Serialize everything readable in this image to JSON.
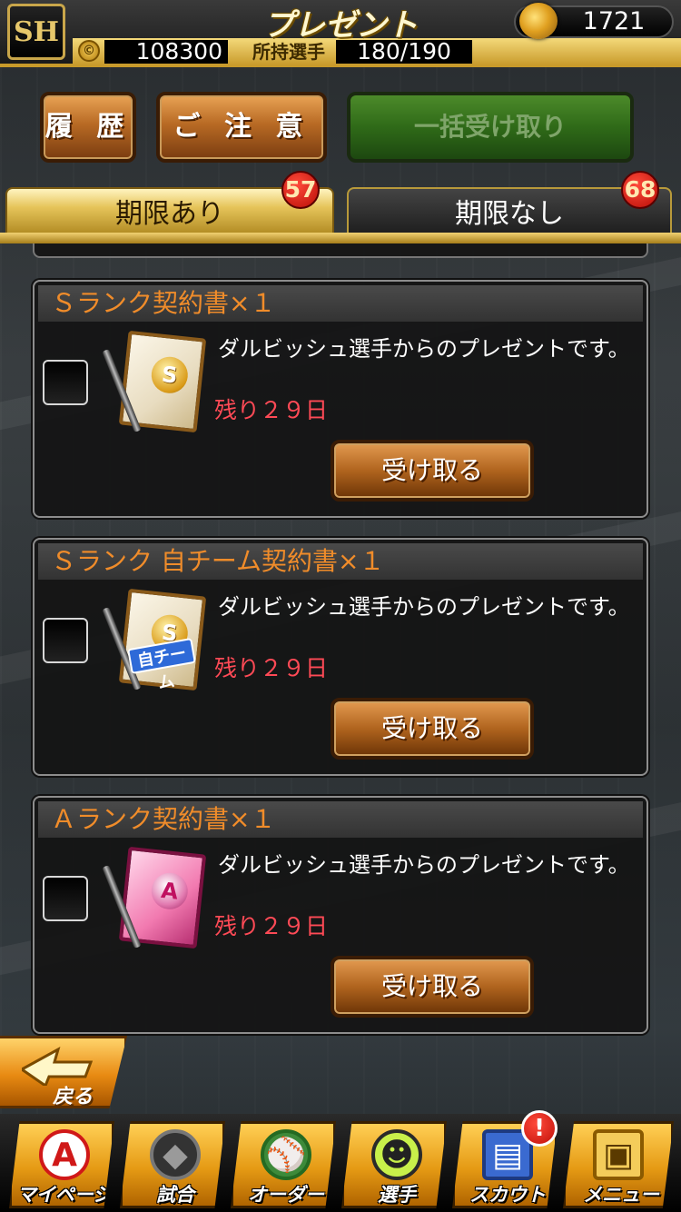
{
  "header": {
    "title": "プレゼント",
    "logo_text": "SH",
    "currency_value": "1721",
    "coins_value": "108300",
    "players_label": "所持選手",
    "players_value": "180/190"
  },
  "top_buttons": {
    "history": "履 歴",
    "caution": "ご 注 意",
    "receive_all": "一括受け取り"
  },
  "tabs": [
    {
      "label": "期限あり",
      "badge": "57",
      "active": true
    },
    {
      "label": "期限なし",
      "badge": "68",
      "active": false
    }
  ],
  "items": [
    {
      "title": "Ｓランク契約書×１",
      "icon": "s-rank-contract-icon",
      "medal": "S",
      "own_team": "",
      "message": "ダルビッシュ選手からのプレゼントです。",
      "remaining": "残り２９日",
      "button": "受け取る"
    },
    {
      "title": "Ｓランク 自チーム契約書×１",
      "icon": "s-rank-own-team-contract-icon",
      "medal": "S",
      "own_team": "自チーム",
      "message": "ダルビッシュ選手からのプレゼントです。",
      "remaining": "残り２９日",
      "button": "受け取る"
    },
    {
      "title": "Ａランク契約書×１",
      "icon": "a-rank-contract-icon",
      "medal": "A",
      "own_team": "",
      "message": "ダルビッシュ選手からのプレゼントです。",
      "remaining": "残り２９日",
      "button": "受け取る"
    }
  ],
  "back_button": {
    "label": "戻る"
  },
  "bottom_nav": [
    {
      "label": "マイページ",
      "icon": "mypage-a-icon",
      "glyph": "A"
    },
    {
      "label": "試合",
      "icon": "stadium-icon",
      "glyph": "◆"
    },
    {
      "label": "オーダー",
      "icon": "field-order-icon",
      "glyph": "⚾"
    },
    {
      "label": "選手",
      "icon": "player-icon",
      "glyph": "☻"
    },
    {
      "label": "スカウト",
      "icon": "scout-book-icon",
      "glyph": "▤"
    },
    {
      "label": "メニュー",
      "icon": "menu-robot-icon",
      "glyph": "▣"
    }
  ],
  "alert": {
    "text": "!"
  },
  "colors": {
    "gold": "#c89a2a",
    "accent_orange": "#f08c2a",
    "remaining_red": "#ff4a56",
    "badge_red": "#c0100a"
  }
}
